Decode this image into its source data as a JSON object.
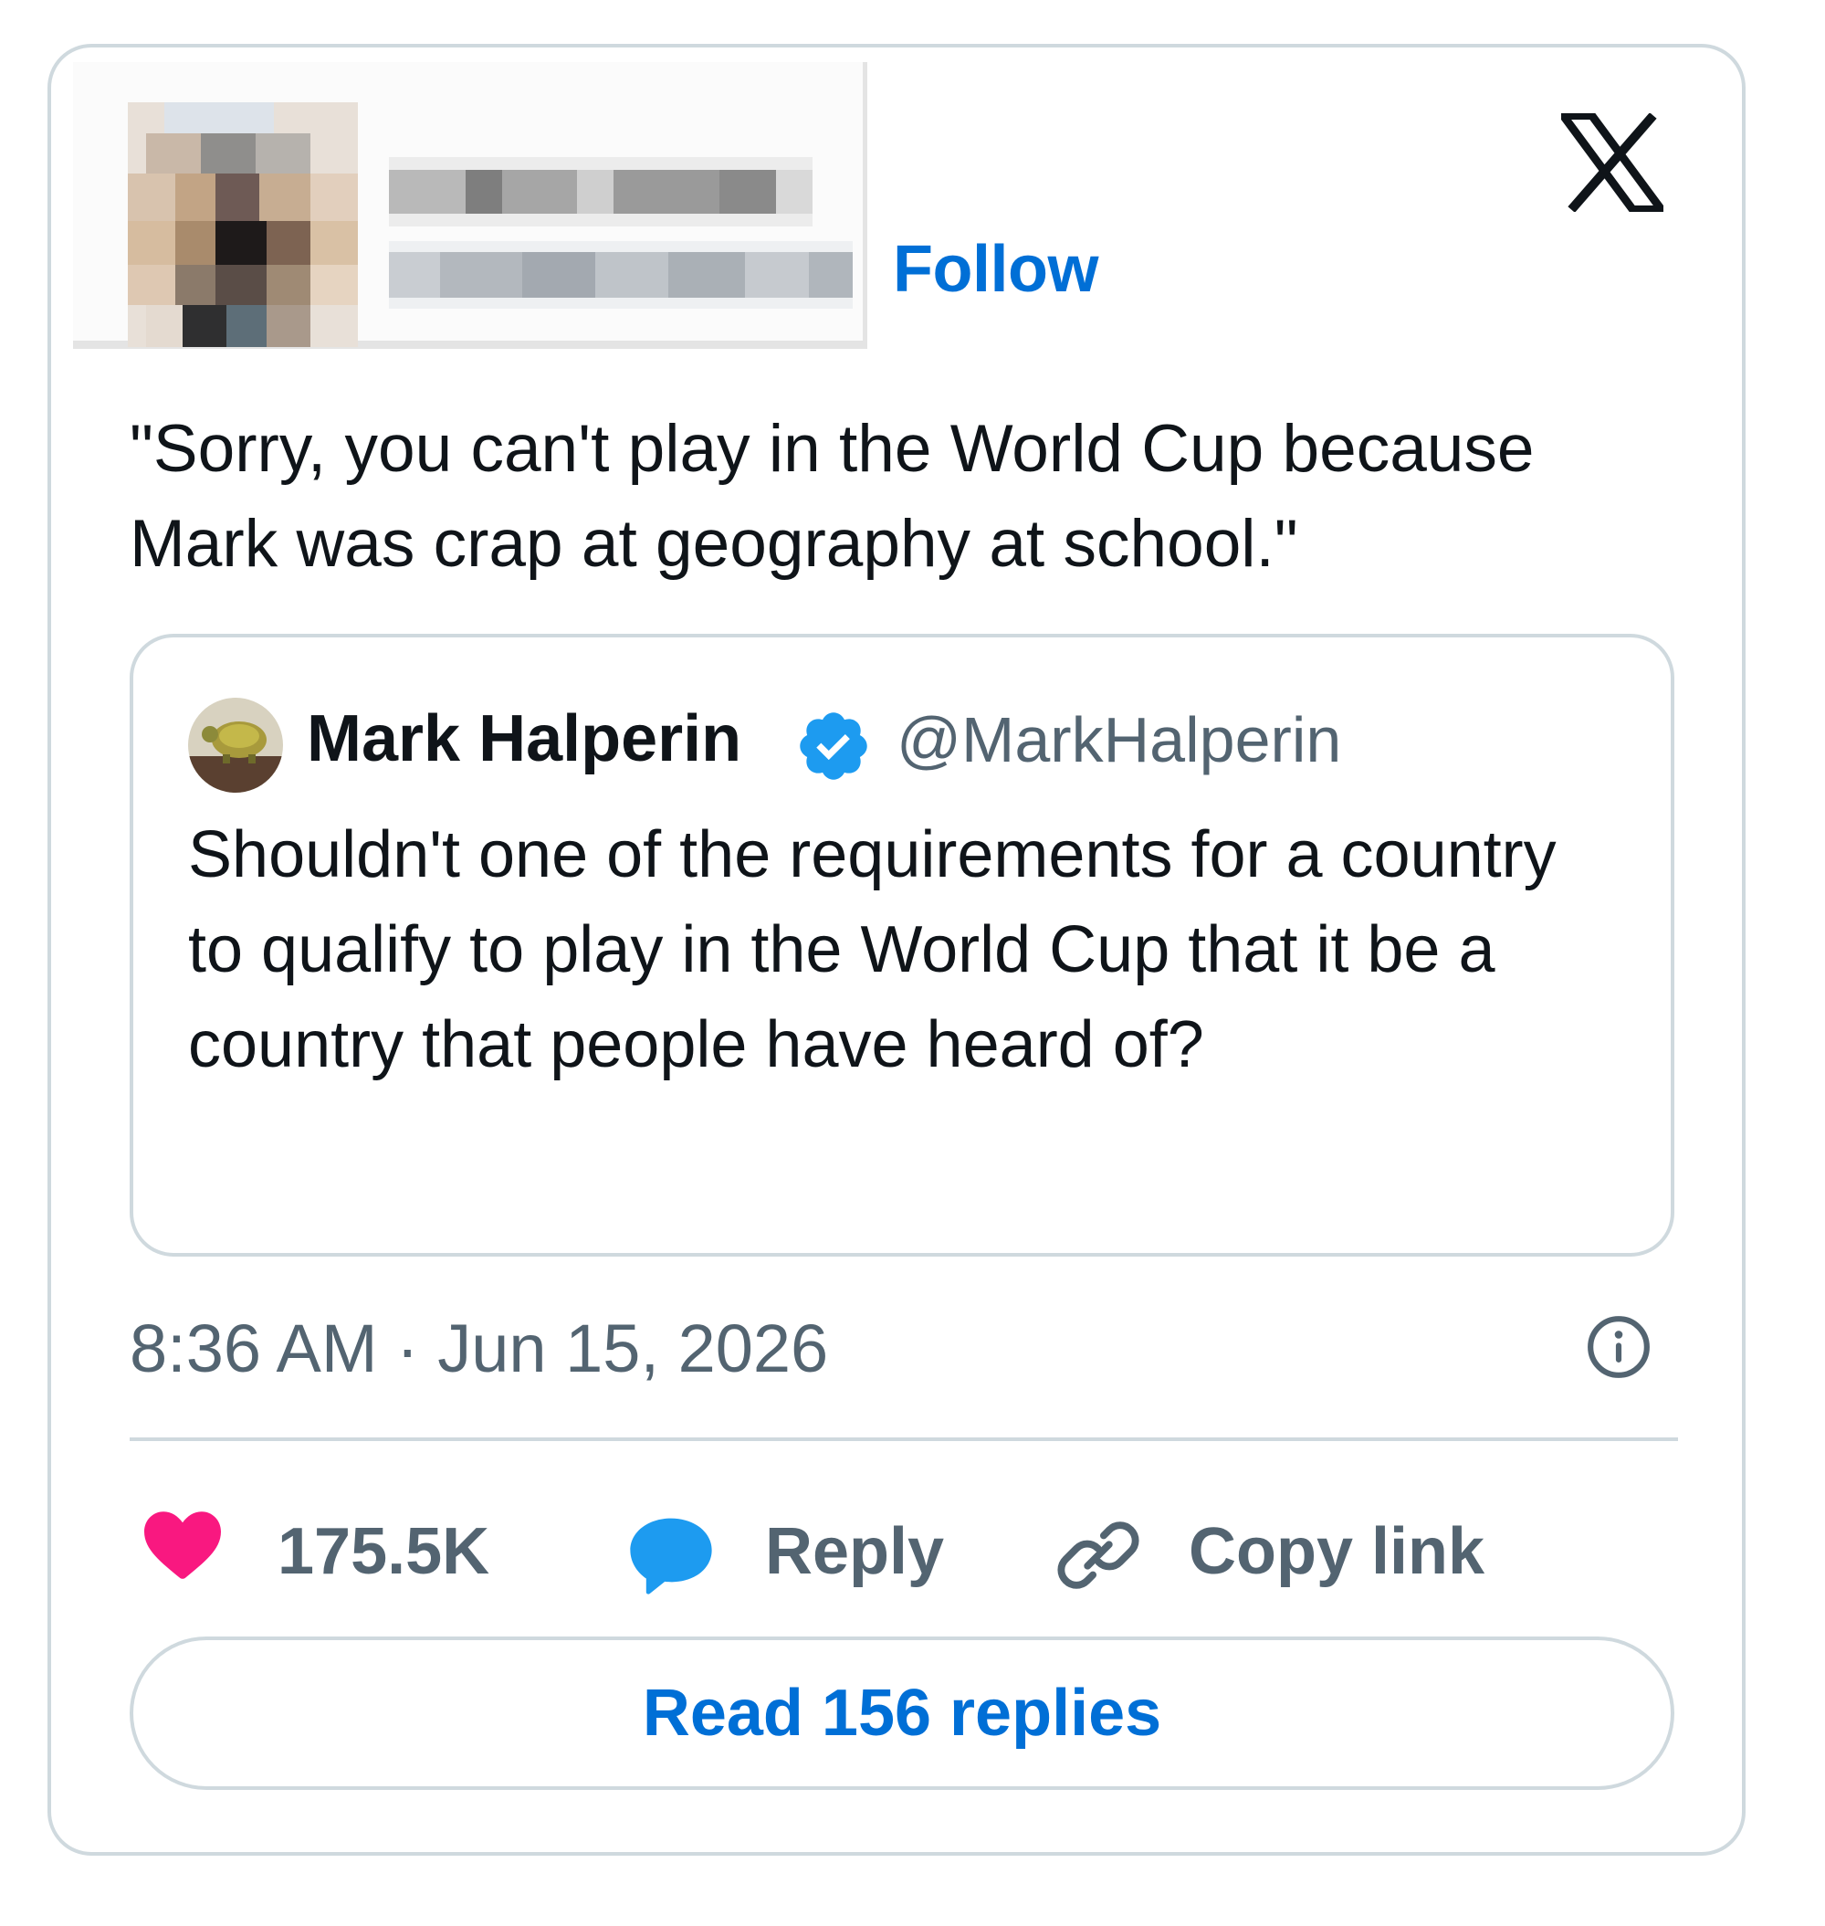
{
  "author": {
    "name_obscured": true,
    "follow_label": "Follow"
  },
  "brand": {
    "logo_icon": "x-logo-icon"
  },
  "tweet": {
    "text": "\"Sorry, you can't play in the World Cup because Mark was crap at geography at school.\"",
    "timestamp": "8:36 AM · Jun 15, 2026"
  },
  "quoted_tweet": {
    "name": "Mark Halperin",
    "handle": "@MarkHalperin",
    "verified": true,
    "text": "Shouldn't one of the requirements for a country to qualify to play in the World Cup that it be a country that people have heard of?"
  },
  "actions": {
    "likes_count": "175.5K",
    "reply_label": "Reply",
    "copy_link_label": "Copy link",
    "read_replies_label": "Read 156 replies"
  },
  "icons": {
    "like": "heart-icon",
    "reply": "speech-bubble-icon",
    "copy": "link-icon",
    "info": "info-icon",
    "verified": "verified-badge-icon"
  },
  "colors": {
    "accent_blue": "#006fd6",
    "like_pink": "#f91880",
    "reply_blue": "#1d9bf0",
    "secondary_text": "#536471",
    "border": "#cfd9de"
  }
}
